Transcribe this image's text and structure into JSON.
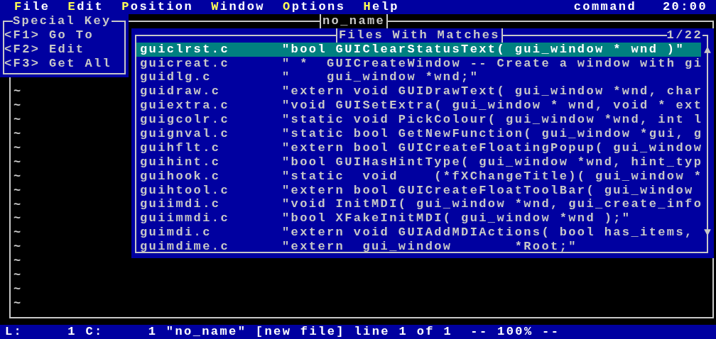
{
  "menu_bar": {
    "items": [
      {
        "hotkey": "F",
        "rest": "ile"
      },
      {
        "hotkey": "E",
        "rest": "dit"
      },
      {
        "hotkey": "P",
        "rest": "osition"
      },
      {
        "hotkey": "W",
        "rest": "indow"
      },
      {
        "hotkey": "O",
        "rest": "ptions"
      },
      {
        "hotkey": "H",
        "rest": "elp"
      }
    ],
    "mode": "command",
    "clock": "20:00"
  },
  "editor": {
    "title": "no_name",
    "tilde_lines": [
      "~",
      "~",
      "~",
      "~",
      "~",
      "~",
      "~",
      "~",
      "~",
      "~",
      "~",
      "~",
      "~",
      "~",
      "~",
      "~"
    ]
  },
  "special_keys": {
    "title": "Special Key",
    "entries": [
      "<F1> Go To",
      "<F2> Edit",
      "<F3> Get All"
    ]
  },
  "matches_popup": {
    "title": "Files With Matches",
    "position": "1/22",
    "items": [
      {
        "file": "guiclrst.c",
        "match": "\"bool GUIClearStatusText( gui_window * wnd )\"",
        "selected": true
      },
      {
        "file": "guicreat.c",
        "match": "\" *  GUICreateWindow -- Create a window with gi",
        "selected": false
      },
      {
        "file": "guidlg.c",
        "match": "\"    gui_window *wnd;\"",
        "selected": false
      },
      {
        "file": "guidraw.c",
        "match": "\"extern void GUIDrawText( gui_window *wnd, char",
        "selected": false
      },
      {
        "file": "guiextra.c",
        "match": "\"void GUISetExtra( gui_window * wnd, void * ext",
        "selected": false
      },
      {
        "file": "guigcolr.c",
        "match": "\"static void PickColour( gui_window *wnd, int l",
        "selected": false
      },
      {
        "file": "guignval.c",
        "match": "\"static bool GetNewFunction( gui_window *gui, g",
        "selected": false
      },
      {
        "file": "guihflt.c",
        "match": "\"extern bool GUICreateFloatingPopup( gui_window",
        "selected": false
      },
      {
        "file": "guihint.c",
        "match": "\"bool GUIHasHintType( gui_window *wnd, hint_typ",
        "selected": false
      },
      {
        "file": "guihook.c",
        "match": "\"static  void    (*fXChangeTitle)( gui_window *",
        "selected": false
      },
      {
        "file": "guihtool.c",
        "match": "\"extern bool GUICreateFloatToolBar( gui_window",
        "selected": false
      },
      {
        "file": "guiimdi.c",
        "match": "\"void InitMDI( gui_window *wnd, gui_create_info",
        "selected": false
      },
      {
        "file": "guiimmdi.c",
        "match": "\"bool XFakeInitMDI( gui_window *wnd );\"",
        "selected": false
      },
      {
        "file": "guimdi.c",
        "match": "\"extern void GUIAddMDIActions( bool has_items,",
        "selected": false
      },
      {
        "file": "guimdime.c",
        "match": "\"extern  gui_window       *Root;\"",
        "selected": false
      }
    ]
  },
  "status_bar": {
    "text": "L:     1 C:     1 \"no_name\" [new file] line 1 of 1  -- 100% --"
  }
}
